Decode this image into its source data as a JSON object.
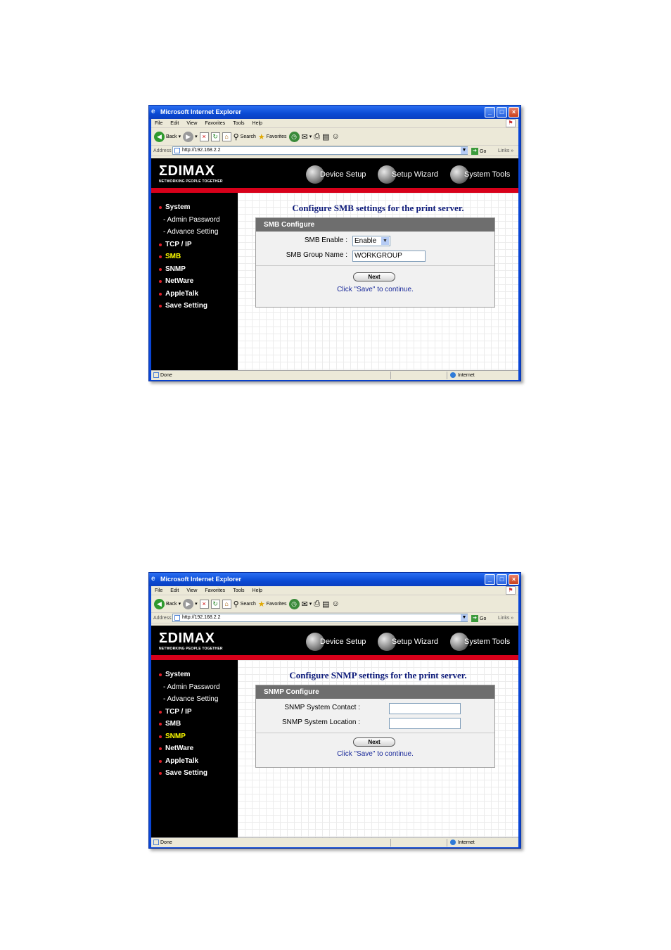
{
  "browser": {
    "window_title": "Microsoft Internet Explorer",
    "menu": [
      "File",
      "Edit",
      "View",
      "Favorites",
      "Tools",
      "Help"
    ],
    "toolbar": {
      "back": "Back",
      "search": "Search",
      "favorites": "Favorites"
    },
    "address_label": "Address",
    "url": "http://192.168.2.2",
    "go_label": "Go",
    "links_label": "Links",
    "status_text": "Done",
    "zone_text": "Internet"
  },
  "banner": {
    "logo": "ΣDIMAX",
    "tagline": "NETWORKING PEOPLE TOGETHER",
    "nav": [
      "Device Setup",
      "Setup Wizard",
      "System Tools"
    ]
  },
  "sidebar_items": [
    "System",
    "- Admin Password",
    "- Advance Setting",
    "TCP / IP",
    "SMB",
    "SNMP",
    "NetWare",
    "AppleTalk",
    "Save Setting"
  ],
  "windows": [
    {
      "page_title": "Configure SMB settings for the print server.",
      "panel_title": "SMB Configure",
      "active_item": "SMB",
      "fields": [
        {
          "label": "SMB Enable :",
          "value": "Enable"
        },
        {
          "label": "SMB Group Name :",
          "value": "WORKGROUP"
        }
      ],
      "next_label": "Next",
      "hint": "Click \"Save\" to continue."
    },
    {
      "page_title": "Configure SNMP settings for the print server.",
      "panel_title": "SNMP Configure",
      "active_item": "SNMP",
      "fields": [
        {
          "label": "SNMP System Contact :",
          "value": ""
        },
        {
          "label": "SNMP System Location :",
          "value": ""
        }
      ],
      "next_label": "Next",
      "hint": "Click \"Save\" to continue."
    }
  ],
  "colors": {
    "banner": "#000000",
    "accent_red": "#d8001a",
    "title_blue": "#0d1a7a",
    "active_nav": "#ffff00"
  }
}
